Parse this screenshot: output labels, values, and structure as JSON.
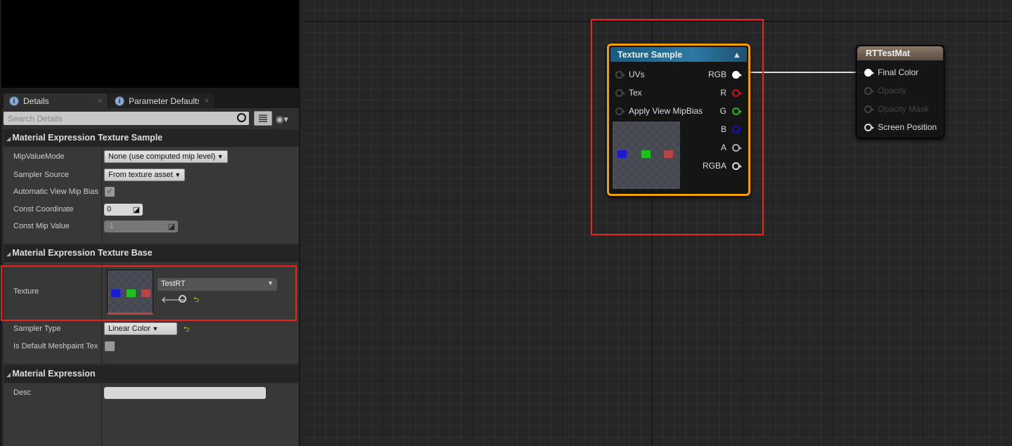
{
  "tabs": [
    {
      "label": "Details",
      "close": "×"
    },
    {
      "label": "Parameter Defaults",
      "close": "×"
    }
  ],
  "search": {
    "placeholder": "Search Details"
  },
  "sections": [
    {
      "title": "Material Expression Texture Sample"
    },
    {
      "title": "Material Expression Texture Base"
    },
    {
      "title": "Material Expression"
    }
  ],
  "props": {
    "mip_value_mode": {
      "label": "MipValueMode",
      "value": "None (use computed mip level)"
    },
    "sampler_source": {
      "label": "Sampler Source",
      "value": "From texture asset"
    },
    "auto_view_mip_bias": {
      "label": "Automatic View Mip Bias",
      "checked": true,
      "check": "✔"
    },
    "const_coordinate": {
      "label": "Const Coordinate",
      "value": "0"
    },
    "const_mip_value": {
      "label": "Const Mip Value",
      "value": "-1"
    },
    "texture": {
      "label": "Texture",
      "value": "TestRT"
    },
    "sampler_type": {
      "label": "Sampler Type",
      "value": "Linear Color"
    },
    "is_default_meshpaint": {
      "label": "Is Default Meshpaint Tex",
      "checked": false
    },
    "desc": {
      "label": "Desc",
      "value": ""
    }
  },
  "reset_icon": "⮌",
  "nodes": {
    "texture_sample": {
      "title": "Texture Sample",
      "inputs": [
        "UVs",
        "Tex",
        "Apply View MipBias"
      ],
      "outputs": [
        "RGB",
        "R",
        "G",
        "B",
        "A",
        "RGBA"
      ],
      "collapse": "▲"
    },
    "rttestmat": {
      "title": "RTTestMat",
      "inputs": [
        "Final Color",
        "Opacity",
        "Opacity Mask",
        "Screen Position"
      ]
    }
  },
  "colors": {
    "selection": "#f0a000",
    "highlight": "#f02418",
    "r": "#d01010",
    "g": "#10c010",
    "b": "#1010d0"
  }
}
